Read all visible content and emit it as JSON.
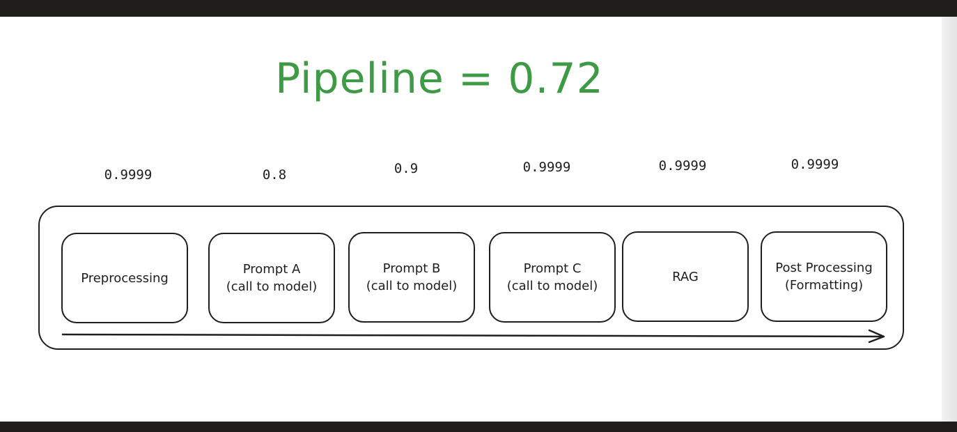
{
  "diagram": {
    "title": "Pipeline = 0.72",
    "title_color": "#3f9a45",
    "stages": [
      {
        "score": "0.9999",
        "line1": "Preprocessing",
        "line2": ""
      },
      {
        "score": "0.8",
        "line1": "Prompt A",
        "line2": "(call to model)"
      },
      {
        "score": "0.9",
        "line1": "Prompt B",
        "line2": "(call to model)"
      },
      {
        "score": "0.9999",
        "line1": "Prompt C",
        "line2": "(call to model)"
      },
      {
        "score": "0.9999",
        "line1": "RAG",
        "line2": ""
      },
      {
        "score": "0.9999",
        "line1": "Post Processing",
        "line2": "(Formatting)"
      }
    ],
    "arrow_direction": "right"
  }
}
